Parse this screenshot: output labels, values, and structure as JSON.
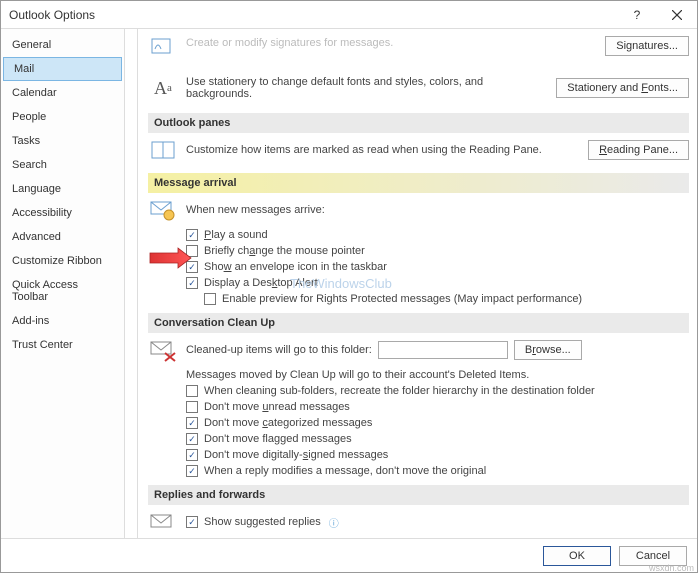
{
  "title": "Outlook Options",
  "sidebar": {
    "items": [
      {
        "label": "General"
      },
      {
        "label": "Mail"
      },
      {
        "label": "Calendar"
      },
      {
        "label": "People"
      },
      {
        "label": "Tasks"
      },
      {
        "label": "Search"
      },
      {
        "label": "Language"
      },
      {
        "label": "Accessibility"
      },
      {
        "label": "Advanced"
      },
      {
        "label": "Customize Ribbon"
      },
      {
        "label": "Quick Access Toolbar"
      },
      {
        "label": "Add-ins"
      },
      {
        "label": "Trust Center"
      }
    ],
    "selected_index": 1
  },
  "truncated_top": {
    "text": "Create or modify signatures for messages.",
    "button": "Signatures..."
  },
  "stationery": {
    "text": "Use stationery to change default fonts and styles, colors, and backgrounds.",
    "button": "Stationery and Fonts..."
  },
  "panes": {
    "header": "Outlook panes",
    "text": "Customize how items are marked as read when using the Reading Pane.",
    "button": "Reading Pane..."
  },
  "arrival": {
    "header": "Message arrival",
    "lead": "When new messages arrive:",
    "items": [
      {
        "checked": true,
        "label": "Play a sound"
      },
      {
        "checked": false,
        "label": "Briefly change the mouse pointer"
      },
      {
        "checked": true,
        "label": "Show an envelope icon in the taskbar"
      },
      {
        "checked": true,
        "label": "Display a Desktop Alert"
      },
      {
        "checked": false,
        "label": "Enable preview for Rights Protected messages (May impact performance)",
        "indent": true
      }
    ]
  },
  "cleanup": {
    "header": "Conversation Clean Up",
    "lead": "Cleaned-up items will go to this folder:",
    "browse": "Browse...",
    "note": "Messages moved by Clean Up will go to their account's Deleted Items.",
    "items": [
      {
        "checked": false,
        "label": "When cleaning sub-folders, recreate the folder hierarchy in the destination folder"
      },
      {
        "checked": false,
        "label": "Don't move unread messages"
      },
      {
        "checked": true,
        "label": "Don't move categorized messages"
      },
      {
        "checked": true,
        "label": "Don't move flagged messages"
      },
      {
        "checked": true,
        "label": "Don't move digitally-signed messages"
      },
      {
        "checked": true,
        "label": "When a reply modifies a message, don't move the original"
      }
    ]
  },
  "replies": {
    "header": "Replies and forwards",
    "items": [
      {
        "checked": true,
        "label": "Show suggested replies"
      }
    ]
  },
  "footer": {
    "ok": "OK",
    "cancel": "Cancel"
  },
  "watermark": "TheWindowsClub",
  "watermark2": "wsxdn.com"
}
